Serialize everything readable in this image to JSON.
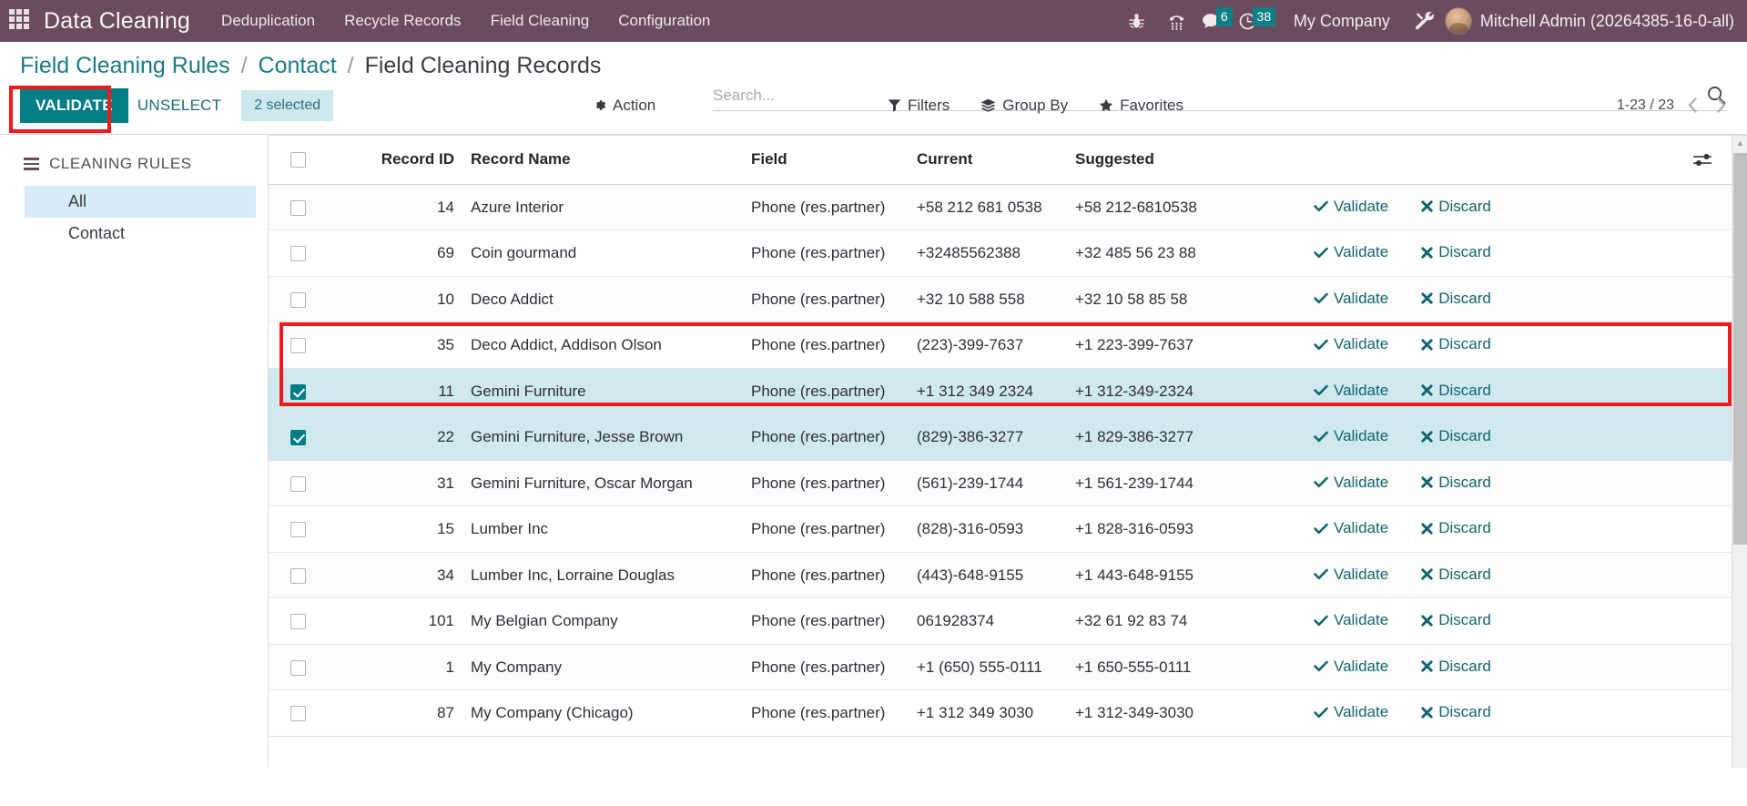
{
  "navbar": {
    "apps_icon": "apps-grid-icon",
    "brand": "Data Cleaning",
    "menu": [
      {
        "label": "Deduplication"
      },
      {
        "label": "Recycle Records"
      },
      {
        "label": "Field Cleaning"
      },
      {
        "label": "Configuration"
      }
    ],
    "icons": [
      {
        "name": "bug-icon"
      },
      {
        "name": "dialpad-icon"
      },
      {
        "name": "messages-icon",
        "badge": "6"
      },
      {
        "name": "activities-clock-icon",
        "badge": "38"
      }
    ],
    "company": "My Company",
    "tools_icon": "tools-wrench-icon",
    "username": "Mitchell Admin (20264385-16-0-all)"
  },
  "breadcrumb": {
    "root": "Field Cleaning Rules",
    "sep1": "/",
    "parent": "Contact",
    "sep2": "/",
    "current": "Field Cleaning Records"
  },
  "search": {
    "placeholder": "Search...",
    "value": "",
    "icon": "search-icon"
  },
  "toolbar": {
    "validate_label": "VALIDATE",
    "unselect_label": "UNSELECT",
    "selected_count": "2 selected",
    "action_label": "Action",
    "action_icon": "gear-icon",
    "filters_label": "Filters",
    "filters_icon": "funnel-icon",
    "groupby_label": "Group By",
    "groupby_icon": "layers-icon",
    "favorites_label": "Favorites",
    "favorites_icon": "star-icon"
  },
  "pager": {
    "range": "1-23 / 23",
    "prev_icon": "chevron-left-icon",
    "next_icon": "chevron-right-icon"
  },
  "sidebar": {
    "title": "CLEANING RULES",
    "toggle_icon": "hamburger-icon",
    "items": [
      {
        "label": "All",
        "active": true
      },
      {
        "label": "Contact",
        "active": false
      }
    ]
  },
  "table": {
    "options_icon": "view-options-sliders-icon",
    "headers": {
      "checkbox": "",
      "record_id": "Record ID",
      "record_name": "Record Name",
      "field": "Field",
      "current": "Current",
      "suggested": "Suggested"
    },
    "row_actions": {
      "validate_label": "Validate",
      "validate_icon": "check-icon",
      "discard_label": "Discard",
      "discard_icon": "x-icon"
    },
    "rows": [
      {
        "selected": false,
        "record_id": "14",
        "record_name": "Azure Interior",
        "field": "Phone (res.partner)",
        "current": "+58 212 681 0538",
        "suggested": "+58 212-6810538"
      },
      {
        "selected": false,
        "record_id": "69",
        "record_name": "Coin gourmand",
        "field": "Phone (res.partner)",
        "current": "+32485562388",
        "suggested": "+32 485 56 23 88"
      },
      {
        "selected": false,
        "record_id": "10",
        "record_name": "Deco Addict",
        "field": "Phone (res.partner)",
        "current": "+32 10 588 558",
        "suggested": "+32 10 58 85 58"
      },
      {
        "selected": false,
        "record_id": "35",
        "record_name": "Deco Addict, Addison Olson",
        "field": "Phone (res.partner)",
        "current": "(223)-399-7637",
        "suggested": "+1 223-399-7637"
      },
      {
        "selected": true,
        "record_id": "11",
        "record_name": "Gemini Furniture",
        "field": "Phone (res.partner)",
        "current": "+1 312 349 2324",
        "suggested": "+1 312-349-2324"
      },
      {
        "selected": true,
        "record_id": "22",
        "record_name": "Gemini Furniture, Jesse Brown",
        "field": "Phone (res.partner)",
        "current": "(829)-386-3277",
        "suggested": "+1 829-386-3277"
      },
      {
        "selected": false,
        "record_id": "31",
        "record_name": "Gemini Furniture, Oscar Morgan",
        "field": "Phone (res.partner)",
        "current": "(561)-239-1744",
        "suggested": "+1 561-239-1744"
      },
      {
        "selected": false,
        "record_id": "15",
        "record_name": "Lumber Inc",
        "field": "Phone (res.partner)",
        "current": "(828)-316-0593",
        "suggested": "+1 828-316-0593"
      },
      {
        "selected": false,
        "record_id": "34",
        "record_name": "Lumber Inc, Lorraine Douglas",
        "field": "Phone (res.partner)",
        "current": "(443)-648-9155",
        "suggested": "+1 443-648-9155"
      },
      {
        "selected": false,
        "record_id": "101",
        "record_name": "My Belgian Company",
        "field": "Phone (res.partner)",
        "current": "061928374",
        "suggested": "+32 61 92 83 74"
      },
      {
        "selected": false,
        "record_id": "1",
        "record_name": "My Company",
        "field": "Phone (res.partner)",
        "current": "+1 (650) 555-0111",
        "suggested": "+1 650-555-0111"
      },
      {
        "selected": false,
        "record_id": "87",
        "record_name": "My Company (Chicago)",
        "field": "Phone (res.partner)",
        "current": "+1 312 349 3030",
        "suggested": "+1 312-349-3030"
      }
    ]
  },
  "colors": {
    "navbar_bg": "#6b4c5f",
    "accent_teal": "#017e84",
    "selected_row_bg": "#cfe9ee",
    "annotation_red": "#f51919",
    "sidebar_active_bg": "#d6ebf5"
  }
}
